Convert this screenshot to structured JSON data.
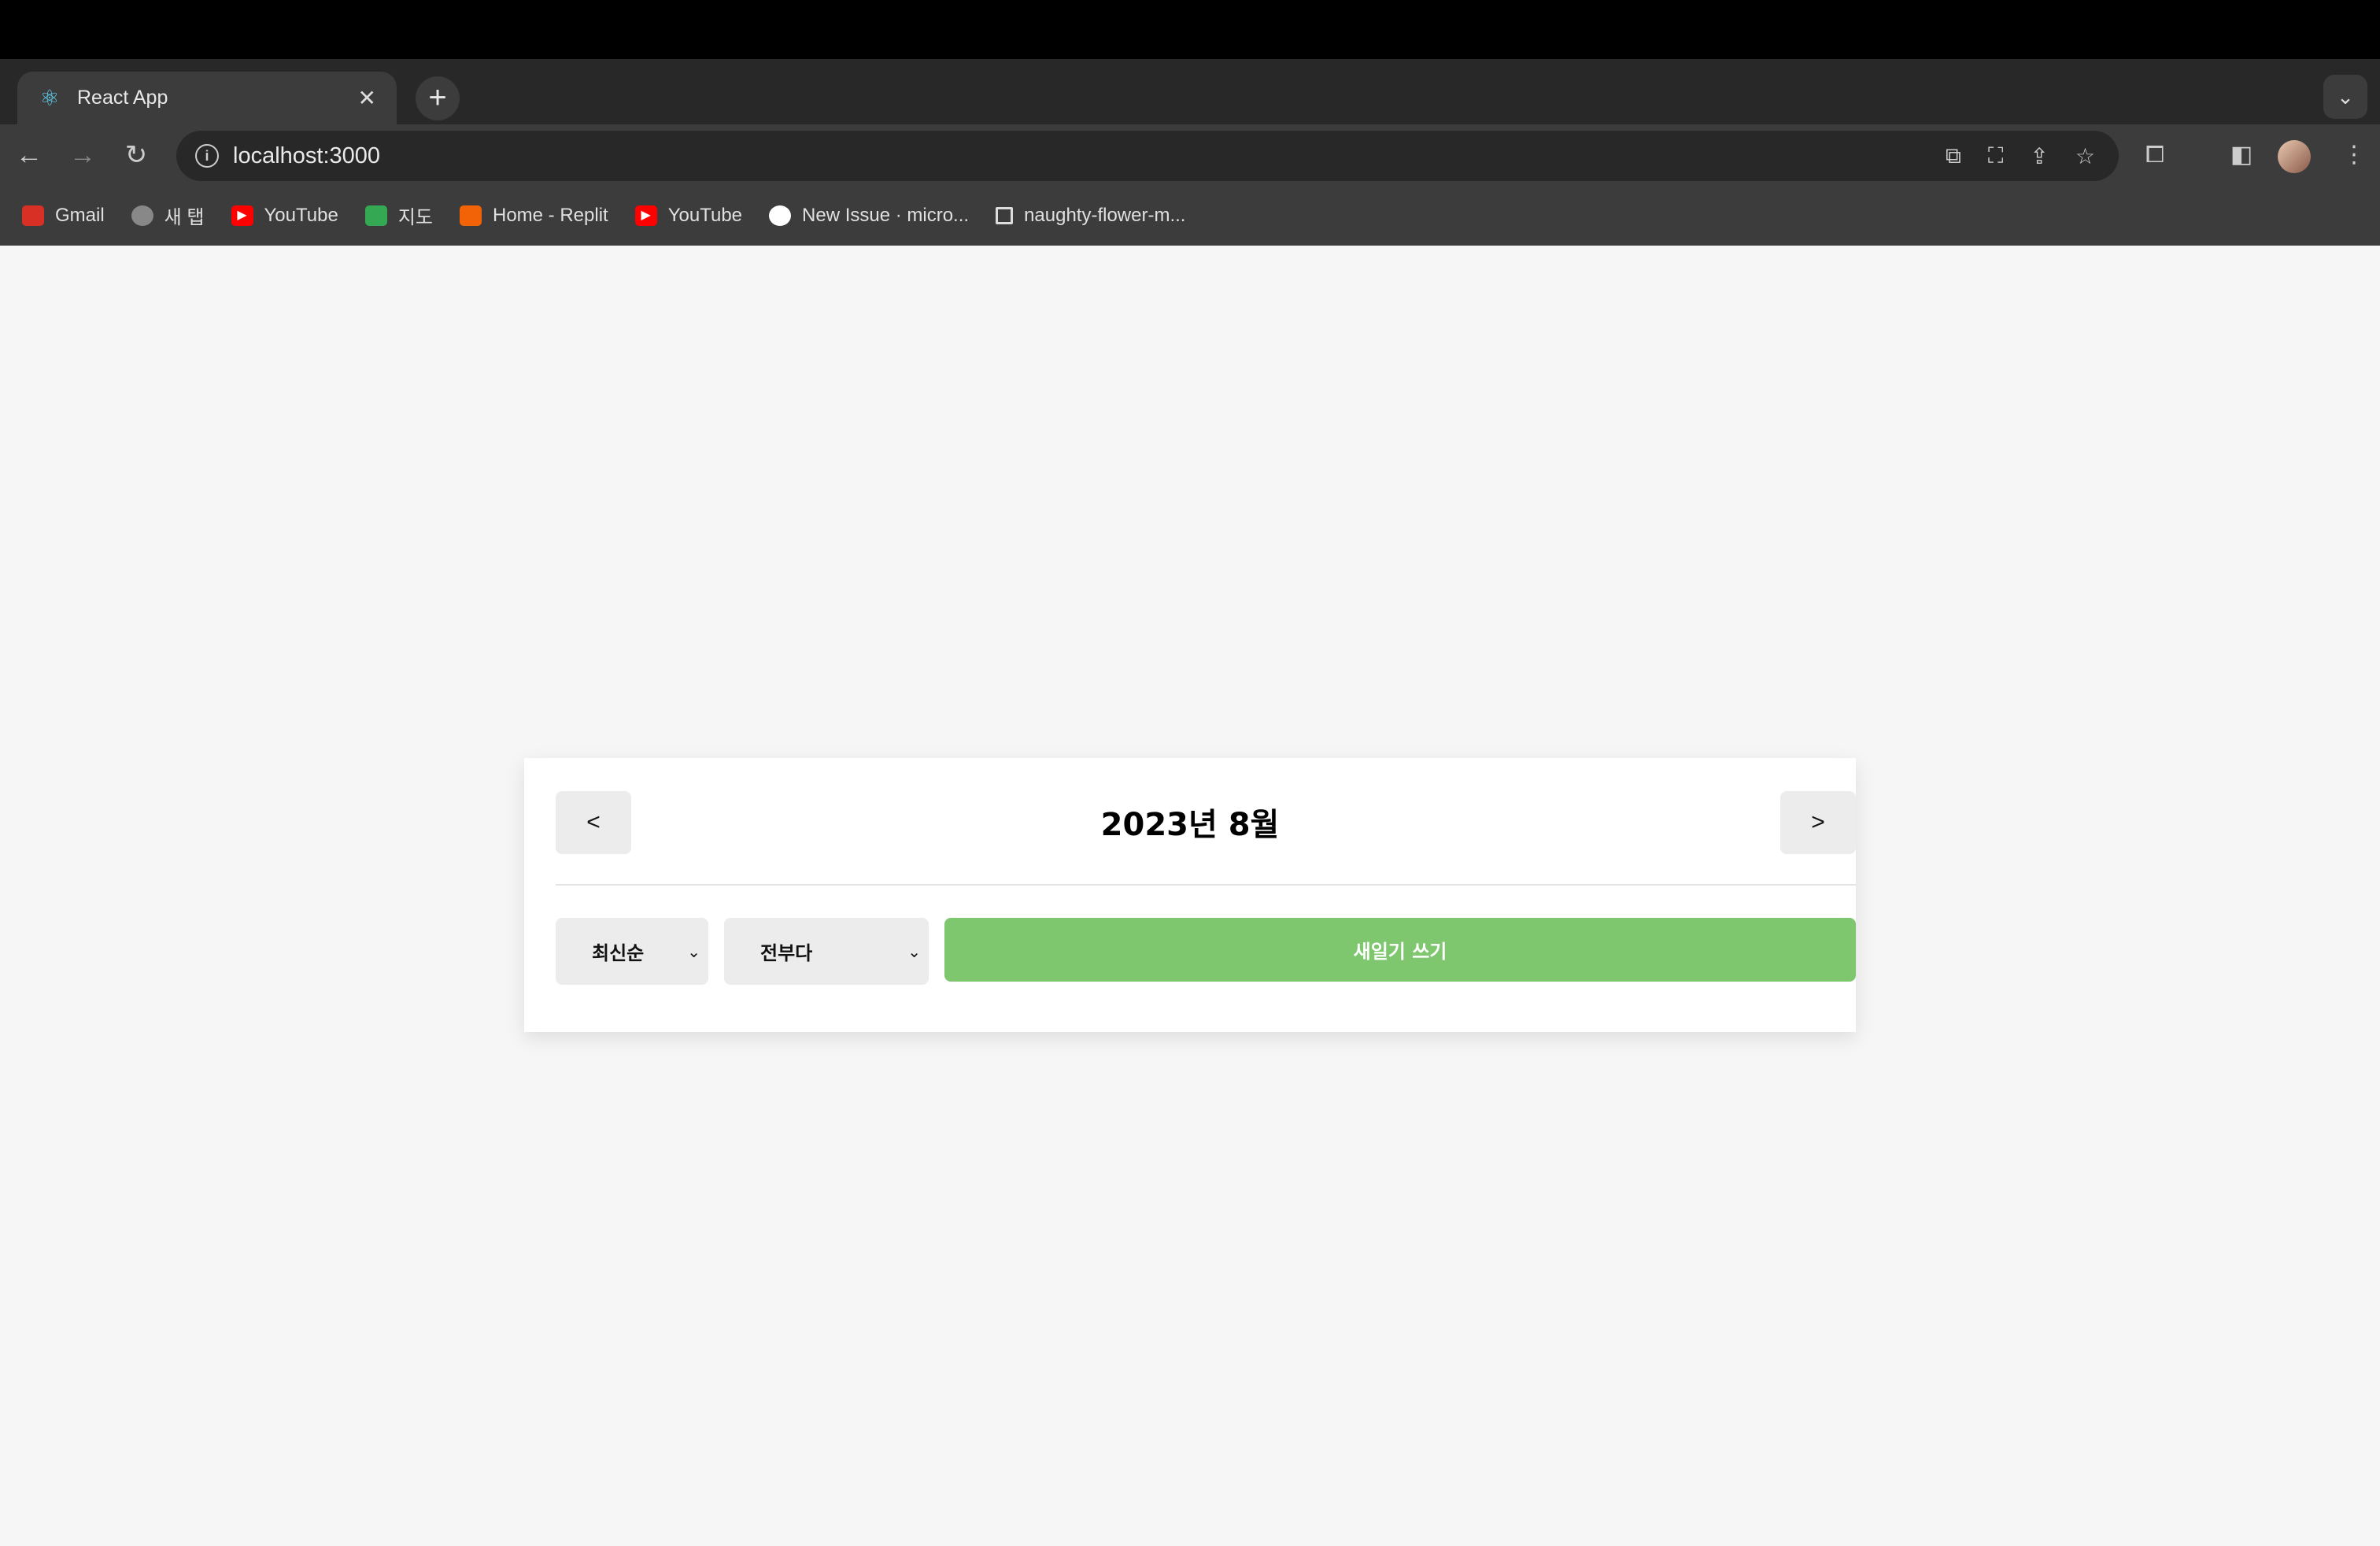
{
  "browser": {
    "tab_title": "React App",
    "url": "localhost:3000",
    "bookmarks": [
      {
        "label": "Gmail",
        "icon": "gmail-icon",
        "color": "#d93025"
      },
      {
        "label": "새 탭",
        "icon": "globe-icon",
        "color": "#888888"
      },
      {
        "label": "YouTube",
        "icon": "youtube-icon",
        "color": "#ff0000"
      },
      {
        "label": "지도",
        "icon": "maps-icon",
        "color": "#34a853"
      },
      {
        "label": "Home - Replit",
        "icon": "replit-icon",
        "color": "#f26207"
      },
      {
        "label": "YouTube",
        "icon": "youtube-icon",
        "color": "#ff0000"
      },
      {
        "label": "New Issue · micro...",
        "icon": "github-icon",
        "color": "#ffffff"
      },
      {
        "label": "naughty-flower-m...",
        "icon": "page-icon",
        "color": "#ffffff"
      }
    ]
  },
  "header": {
    "title": "2023년 8월",
    "prev_label": "<",
    "next_label": ">"
  },
  "controls": {
    "sort_selected": "최신순",
    "filter_selected": "전부다",
    "new_button": "새일기 쓰기",
    "accent": "#7fc76f"
  }
}
